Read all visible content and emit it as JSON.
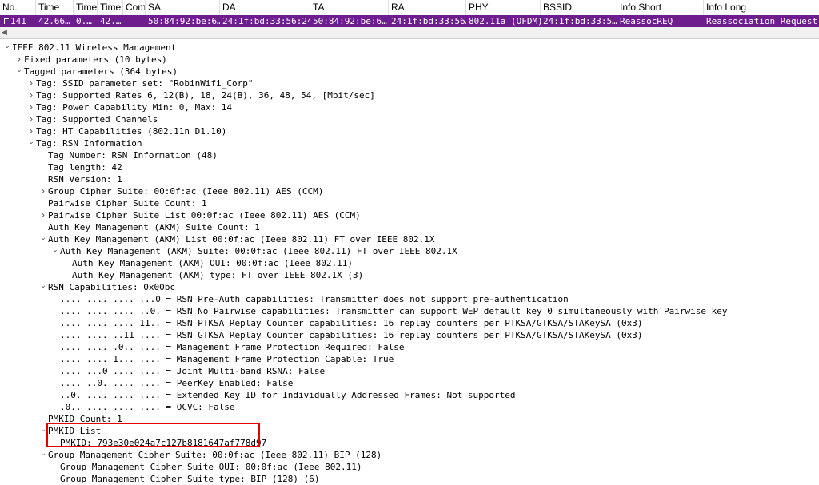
{
  "columns": [
    {
      "id": "no",
      "label": "No."
    },
    {
      "id": "time",
      "label": "Time"
    },
    {
      "id": "time2",
      "label": "Time"
    },
    {
      "id": "time3",
      "label": "Time"
    },
    {
      "id": "com",
      "label": "Com"
    },
    {
      "id": "sa",
      "label": "SA"
    },
    {
      "id": "da",
      "label": "DA"
    },
    {
      "id": "ta",
      "label": "TA"
    },
    {
      "id": "ra",
      "label": "RA"
    },
    {
      "id": "phy",
      "label": "PHY"
    },
    {
      "id": "bssid",
      "label": "BSSID"
    },
    {
      "id": "info_short",
      "label": "Info Short"
    },
    {
      "id": "info_long",
      "label": "Info Long"
    }
  ],
  "packet_row": {
    "no": "141",
    "time": "42.66…",
    "time2": "0.…",
    "time3": "42.…",
    "com": "",
    "sa": "50:84:92:be:6…",
    "da": "24:1f:bd:33:56:24",
    "ta": "50:84:92:be:6…",
    "ra": "24:1f:bd:33:56…",
    "phy": "802.11a (OFDM)",
    "bssid": "24:1f:bd:33:5…",
    "info_short": "ReassocREQ",
    "info_long": "Reassociation Request,"
  },
  "tree": [
    {
      "text": "IEEE 802.11 Wireless Management",
      "icon": "chevron-down"
    },
    {
      "text": "Fixed parameters (10 bytes)",
      "icon": "chevron-right"
    },
    {
      "text": "Tagged parameters (364 bytes)",
      "icon": "chevron-down"
    },
    {
      "text": "Tag: SSID parameter set: \"RobinWifi_Corp\"",
      "icon": "chevron-right"
    },
    {
      "text": "Tag: Supported Rates 6, 12(B), 18, 24(B), 36, 48, 54, [Mbit/sec]",
      "icon": "chevron-right"
    },
    {
      "text": "Tag: Power Capability Min: 0, Max: 14",
      "icon": "chevron-right"
    },
    {
      "text": "Tag: Supported Channels",
      "icon": "chevron-right"
    },
    {
      "text": "Tag: HT Capabilities (802.11n D1.10)",
      "icon": "chevron-right"
    },
    {
      "text": "Tag: RSN Information",
      "icon": "chevron-down"
    },
    {
      "text": "Tag Number: RSN Information (48)",
      "icon": ""
    },
    {
      "text": "Tag length: 42",
      "icon": ""
    },
    {
      "text": "RSN Version: 1",
      "icon": ""
    },
    {
      "text": "Group Cipher Suite: 00:0f:ac (Ieee 802.11) AES (CCM)",
      "icon": "chevron-right"
    },
    {
      "text": "Pairwise Cipher Suite Count: 1",
      "icon": ""
    },
    {
      "text": "Pairwise Cipher Suite List 00:0f:ac (Ieee 802.11) AES (CCM)",
      "icon": "chevron-right"
    },
    {
      "text": "Auth Key Management (AKM) Suite Count: 1",
      "icon": ""
    },
    {
      "text": "Auth Key Management (AKM) List 00:0f:ac (Ieee 802.11) FT over IEEE 802.1X",
      "icon": "chevron-down"
    },
    {
      "text": "Auth Key Management (AKM) Suite: 00:0f:ac (Ieee 802.11) FT over IEEE 802.1X",
      "icon": "chevron-down"
    },
    {
      "text": "Auth Key Management (AKM) OUI: 00:0f:ac (Ieee 802.11)",
      "icon": ""
    },
    {
      "text": "Auth Key Management (AKM) type: FT over IEEE 802.1X (3)",
      "icon": ""
    },
    {
      "text": "RSN Capabilities: 0x00bc",
      "icon": "chevron-down"
    },
    {
      "text": ".... .... .... ...0 = RSN Pre-Auth capabilities: Transmitter does not support pre-authentication",
      "icon": ""
    },
    {
      "text": ".... .... .... ..0. = RSN No Pairwise capabilities: Transmitter can support WEP default key 0 simultaneously with Pairwise key",
      "icon": ""
    },
    {
      "text": ".... .... .... 11.. = RSN PTKSA Replay Counter capabilities: 16 replay counters per PTKSA/GTKSA/STAKeySA (0x3)",
      "icon": ""
    },
    {
      "text": ".... .... ..11 .... = RSN GTKSA Replay Counter capabilities: 16 replay counters per PTKSA/GTKSA/STAKeySA (0x3)",
      "icon": ""
    },
    {
      "text": ".... .... .0.. .... = Management Frame Protection Required: False",
      "icon": ""
    },
    {
      "text": ".... .... 1... .... = Management Frame Protection Capable: True",
      "icon": ""
    },
    {
      "text": ".... ...0 .... .... = Joint Multi-band RSNA: False",
      "icon": ""
    },
    {
      "text": ".... ..0. .... .... = PeerKey Enabled: False",
      "icon": ""
    },
    {
      "text": "..0. .... .... .... = Extended Key ID for Individually Addressed Frames: Not supported",
      "icon": ""
    },
    {
      "text": ".0.. .... .... .... = OCVC: False",
      "icon": ""
    },
    {
      "text": "PMKID Count: 1",
      "icon": ""
    },
    {
      "text": "PMKID List",
      "icon": "chevron-down"
    },
    {
      "text": "PMKID: 793e30e024a7c127b8181647af778d97",
      "icon": ""
    },
    {
      "text": "Group Management Cipher Suite: 00:0f:ac (Ieee 802.11) BIP (128)",
      "icon": "chevron-down"
    },
    {
      "text": "Group Management Cipher Suite OUI: 00:0f:ac (Ieee 802.11)",
      "icon": ""
    },
    {
      "text": "Group Management Cipher Suite type: BIP (128) (6)",
      "icon": ""
    }
  ],
  "colors": {
    "selected_row_bg": "#6d1d8e",
    "selected_row_fg": "#ffffff",
    "highlight_border": "#e00000"
  }
}
